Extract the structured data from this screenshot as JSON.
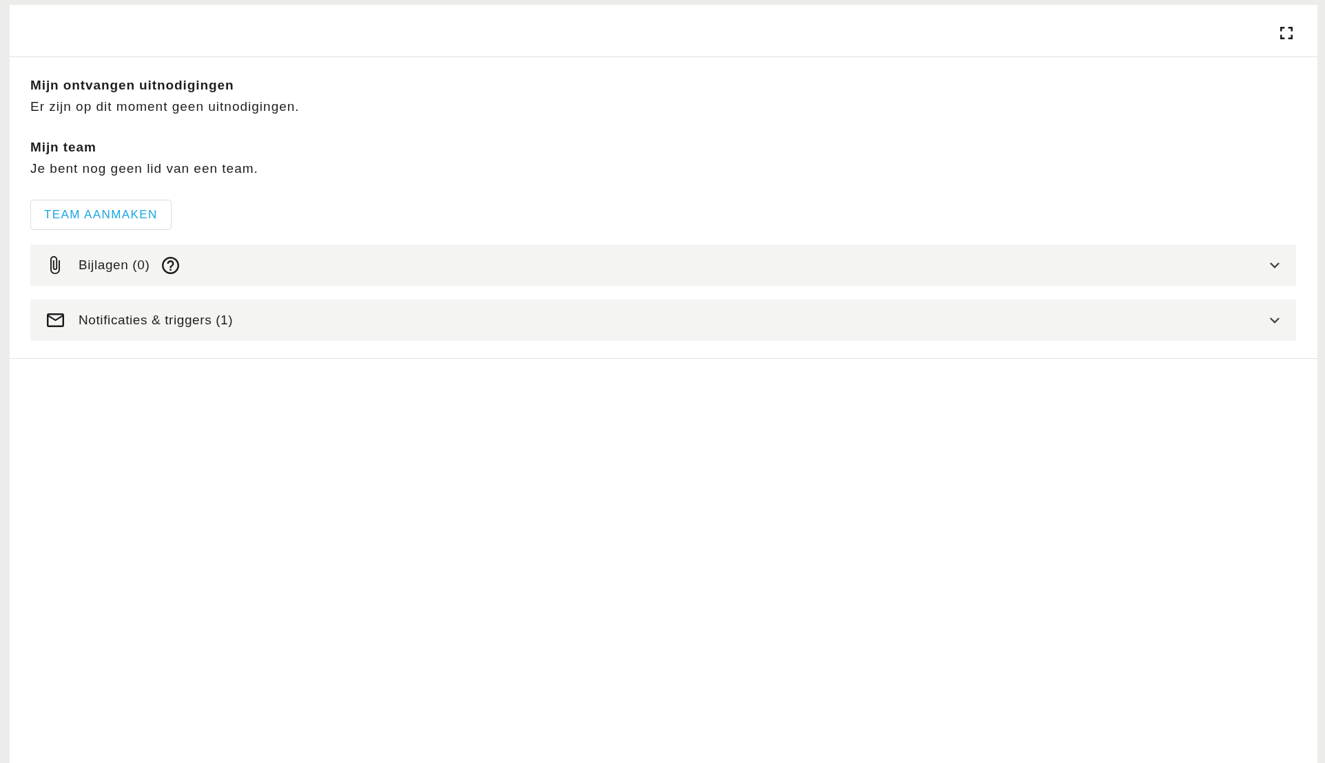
{
  "sections": [
    {
      "title": "Mijn ontvangen uitnodigingen",
      "text": "Er zijn op dit moment geen uitnodigingen."
    },
    {
      "title": "Mijn team",
      "text": "Je bent nog geen lid van een team."
    }
  ],
  "create_team_button": "TEAM AANMAKEN",
  "panels": [
    {
      "kind": "attachments",
      "label": "Bijlagen (0)",
      "help": true,
      "expanded": false
    },
    {
      "kind": "notifications",
      "label": "Notificaties & triggers (1)",
      "help": false,
      "expanded": false
    }
  ]
}
